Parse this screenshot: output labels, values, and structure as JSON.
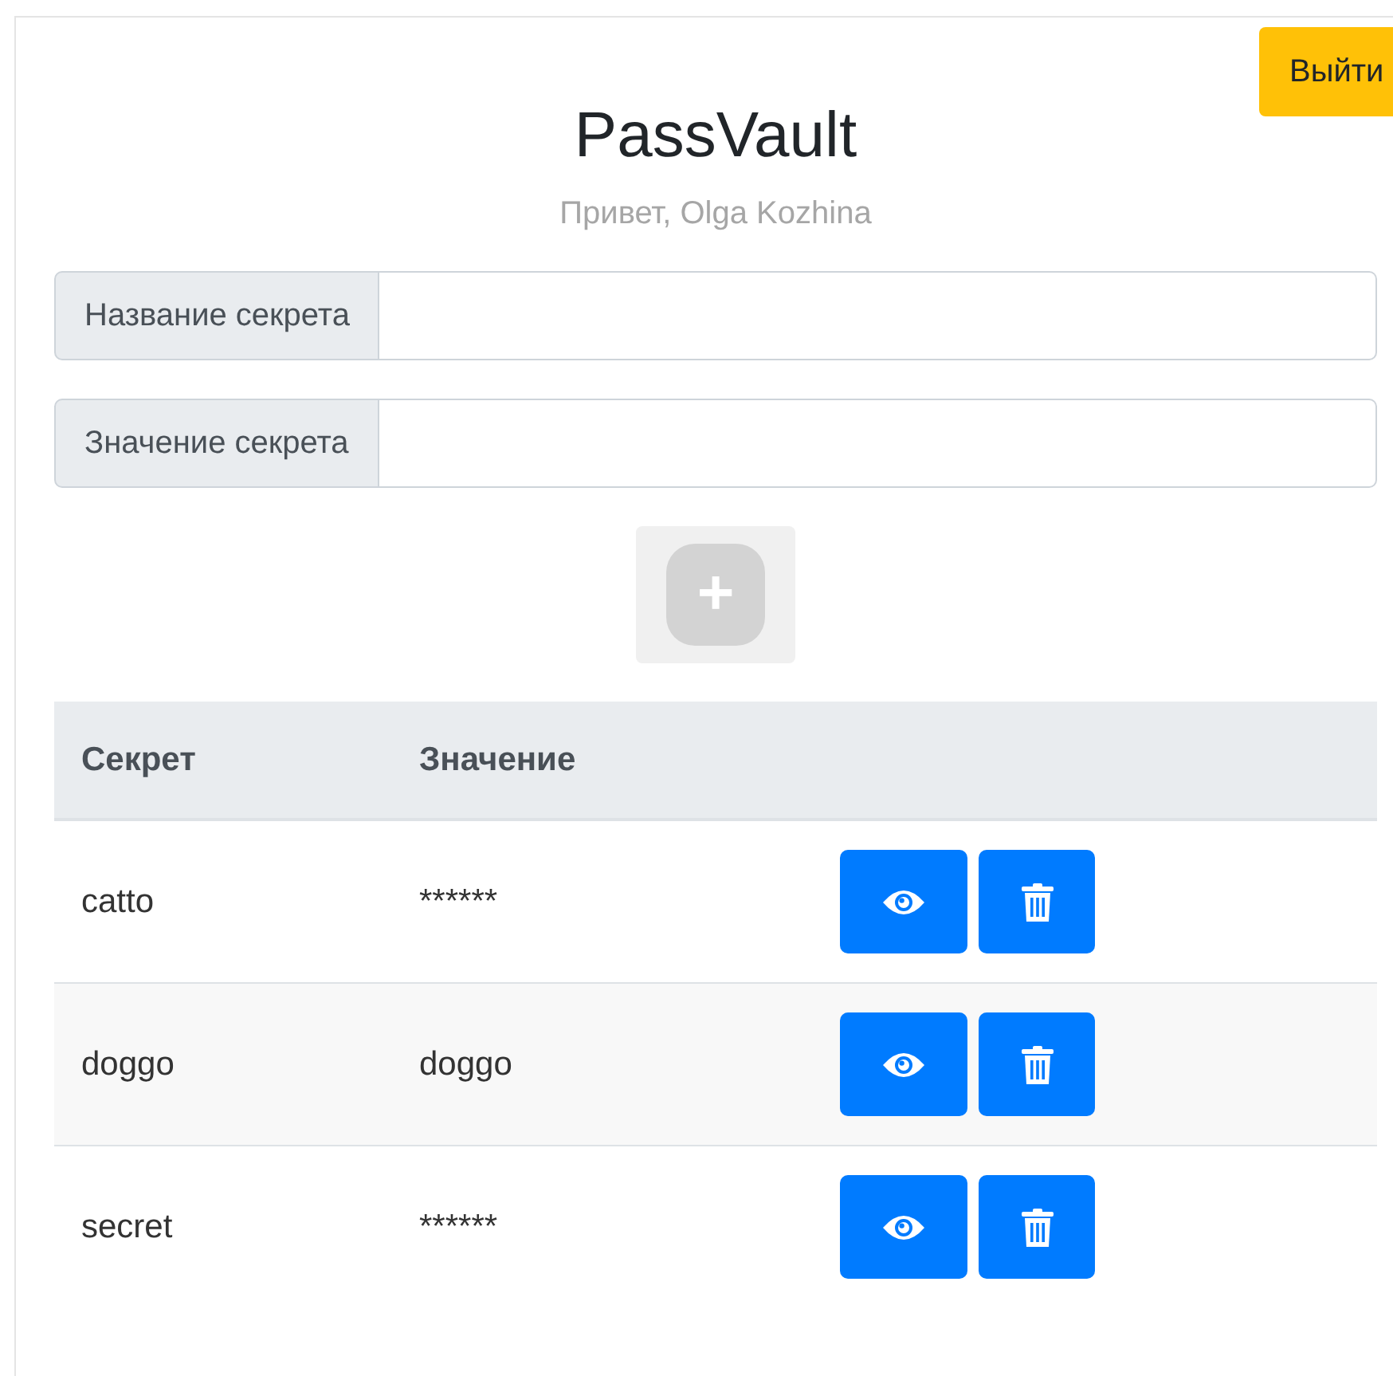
{
  "logout_button": {
    "label": "Выйти"
  },
  "title": "PassVault",
  "greeting": "Привет, Olga Kozhina",
  "fields": [
    {
      "label": "Название секрета"
    },
    {
      "label": "Значение секрета"
    }
  ],
  "add_button": {
    "label": "+",
    "disabled": true
  },
  "table": {
    "columns": [
      "Секрет",
      "Значение"
    ],
    "rows": [
      {
        "secret": "catto",
        "value": "******"
      },
      {
        "secret": "doggo",
        "value": "doggo"
      },
      {
        "secret": "secret",
        "value": "******"
      }
    ]
  }
}
